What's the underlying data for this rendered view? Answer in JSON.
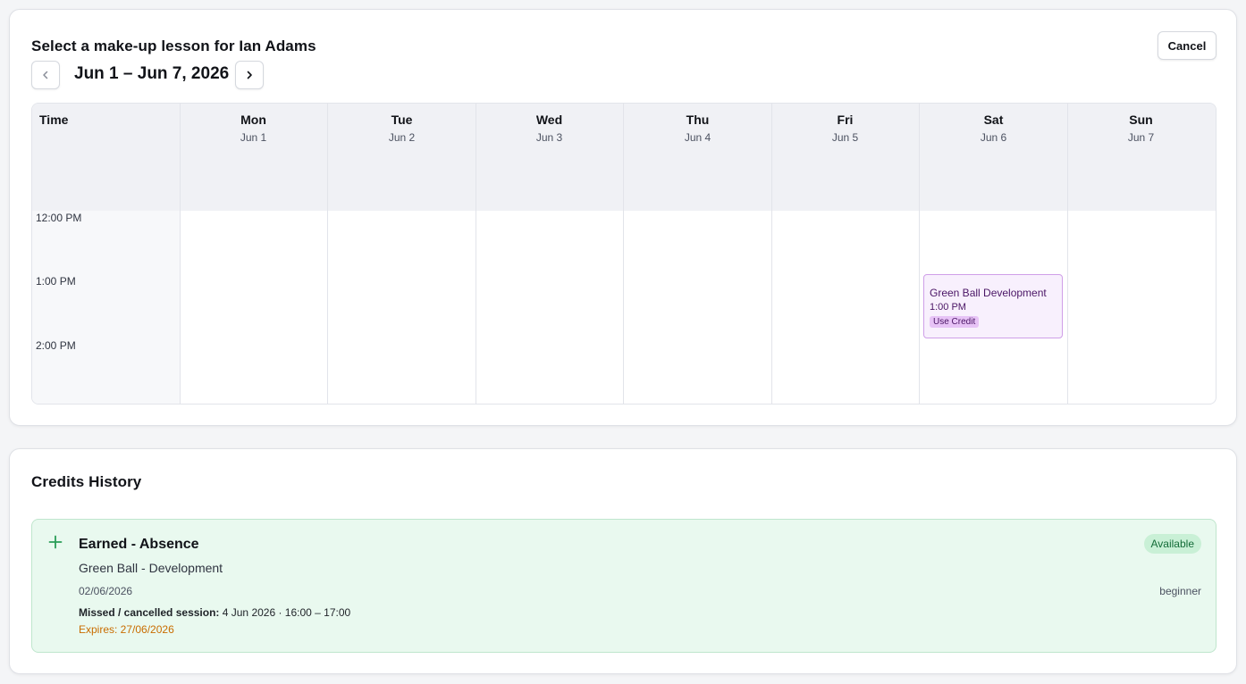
{
  "calendar": {
    "title": "Select a make-up lesson for Ian Adams",
    "cancel_label": "Cancel",
    "week_range": "Jun 1 – Jun 7, 2026",
    "time_header": "Time",
    "days": [
      {
        "name": "Mon",
        "date": "Jun 1"
      },
      {
        "name": "Tue",
        "date": "Jun 2"
      },
      {
        "name": "Wed",
        "date": "Jun 3"
      },
      {
        "name": "Thu",
        "date": "Jun 4"
      },
      {
        "name": "Fri",
        "date": "Jun 5"
      },
      {
        "name": "Sat",
        "date": "Jun 6"
      },
      {
        "name": "Sun",
        "date": "Jun 7"
      }
    ],
    "time_slots": [
      "12:00 PM",
      "1:00 PM",
      "2:00 PM"
    ],
    "event": {
      "title": "Green Ball Development",
      "time": "1:00 PM",
      "badge": "Use Credit",
      "day": "Sat"
    },
    "colors": {
      "event_bg": "#f8f0fd",
      "event_border": "#cf9fe8",
      "event_text": "#4a1565"
    },
    "icons": {
      "prev": "chevron-left-icon",
      "next": "chevron-right-icon"
    }
  },
  "credits": {
    "title": "Credits History",
    "items": [
      {
        "icon": "plus-icon",
        "title": "Earned - Absence",
        "subtitle": "Green Ball - Development",
        "date": "02/06/2026",
        "missed_label": "Missed / cancelled session:",
        "missed_value": "4 Jun 2026 · 16:00 – 17:00",
        "expires": "Expires: 27/06/2026",
        "status": "Available",
        "level": "beginner"
      }
    ],
    "colors": {
      "item_bg": "#e9f9ef",
      "status_bg": "#c9f0d6",
      "expires": "#c96d00",
      "plus": "#2a9d57"
    }
  }
}
